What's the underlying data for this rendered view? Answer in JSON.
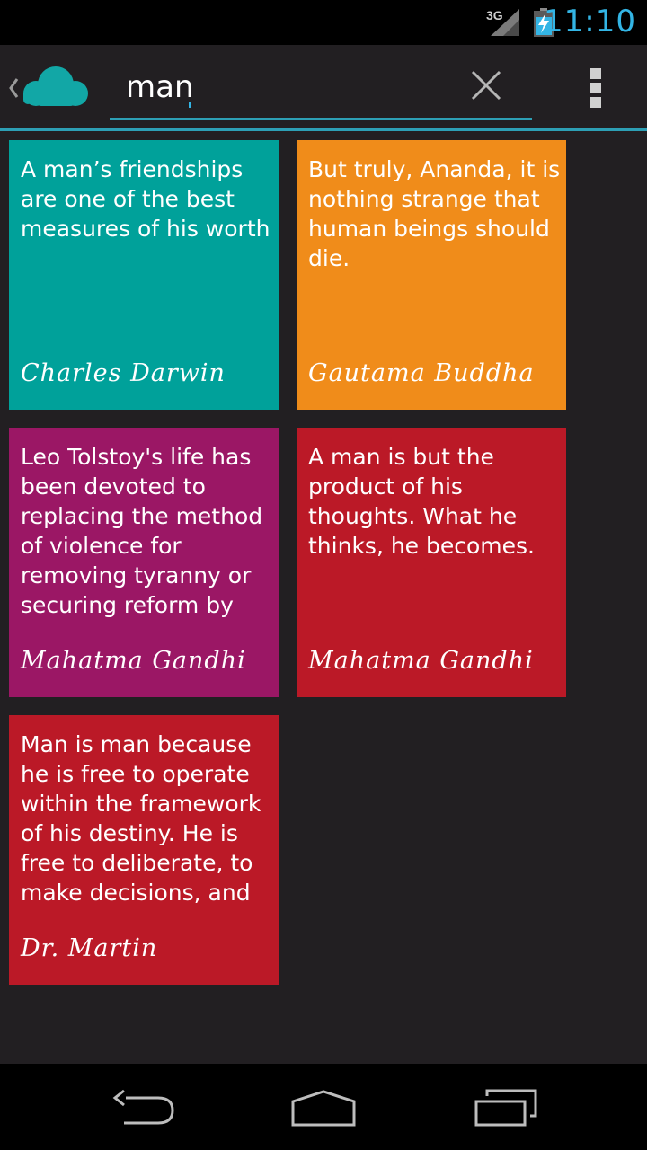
{
  "status_bar": {
    "network": "3G",
    "time": "11:10",
    "icons": [
      "signal-icon",
      "battery-charging-icon"
    ],
    "accent_color": "#33b5e5"
  },
  "action_bar": {
    "icons": [
      "up-caret-icon",
      "cloud-app-icon",
      "clear-icon",
      "overflow-menu-icon"
    ],
    "search": {
      "value": "man",
      "placeholder": ""
    },
    "accent_color": "#2d9fb5"
  },
  "cards": [
    {
      "quote": "A man’s friendships are one of the best measures of his worth",
      "author": "Charles Darwin",
      "color": "#00a19a"
    },
    {
      "quote": "But truly, Ananda, it is nothing strange that human beings should die.",
      "author": "Gautama Buddha",
      "color": "#f08c1a"
    },
    {
      "quote": "Leo Tolstoy's life has been devoted to replacing the method of violence for removing tyranny or securing reform by",
      "author": "Mahatma Gandhi",
      "color": "#9b1765"
    },
    {
      "quote": "A man is but the product of his thoughts. What he thinks, he becomes.",
      "author": "Mahatma Gandhi",
      "color": "#bb1927"
    },
    {
      "quote": "Man is man because he is free to operate within the framework of his destiny. He is free to deliberate, to make decisions, and",
      "author": "Dr. Martin",
      "color": "#bb1927"
    }
  ],
  "nav_bar": {
    "icons": [
      "back-icon",
      "home-icon",
      "recent-apps-icon"
    ]
  }
}
